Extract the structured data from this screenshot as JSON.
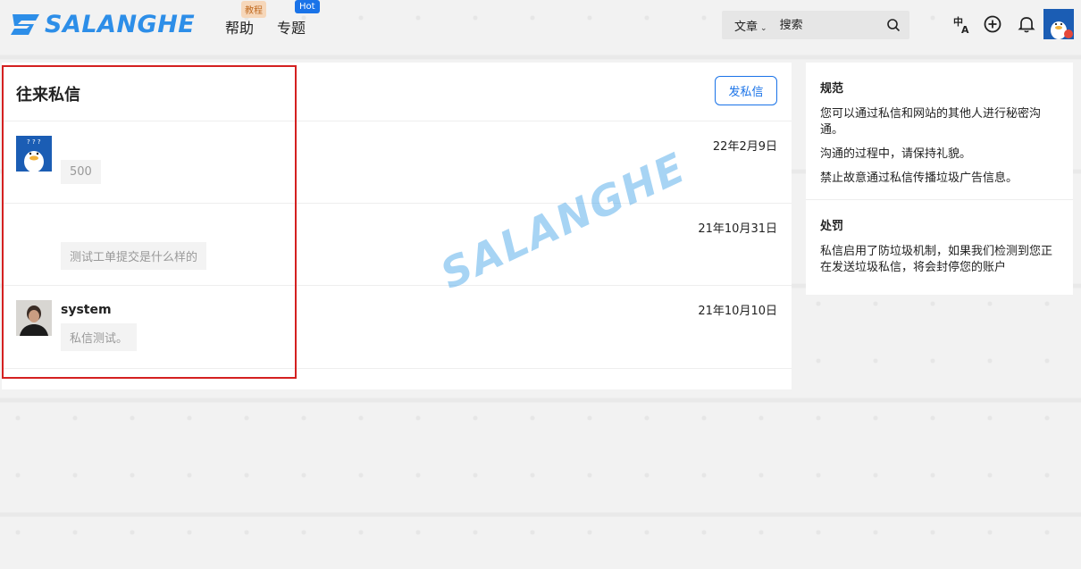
{
  "header": {
    "logo_text": "SALANGHE",
    "nav": [
      {
        "label": "帮助",
        "badge": "教程"
      },
      {
        "label": "专题",
        "badge": "Hot"
      }
    ],
    "search": {
      "type_label": "文章",
      "placeholder": "搜索"
    },
    "icons": [
      "translate-icon",
      "plus-circle-icon",
      "bell-icon",
      "user-avatar"
    ]
  },
  "main": {
    "title": "往来私信",
    "send_button": "发私信",
    "messages": [
      {
        "name": "",
        "preview": "500",
        "date": "22年2月9日"
      },
      {
        "name": "",
        "preview": "测试工单提交是什么样的",
        "date": "21年10月31日"
      },
      {
        "name": "system",
        "preview": "私信测试。",
        "date": "21年10月10日"
      }
    ]
  },
  "sidebar": {
    "rules_title": "规范",
    "rules": [
      "您可以通过私信和网站的其他人进行秘密沟通。",
      "沟通的过程中，请保持礼貌。",
      "禁止故意通过私信传播垃圾广告信息。"
    ],
    "penalty_title": "处罚",
    "penalty_text": "私信启用了防垃圾机制，如果我们检测到您正在发送垃圾私信，将会封停您的账户"
  },
  "watermark": "SALANGHE",
  "colors": {
    "accent": "#1a73e8",
    "logo": "#2d8ee8",
    "highlight": "#d42020",
    "hot_badge": "#1a73e8",
    "tutorial_badge": "#f6d7ba"
  }
}
